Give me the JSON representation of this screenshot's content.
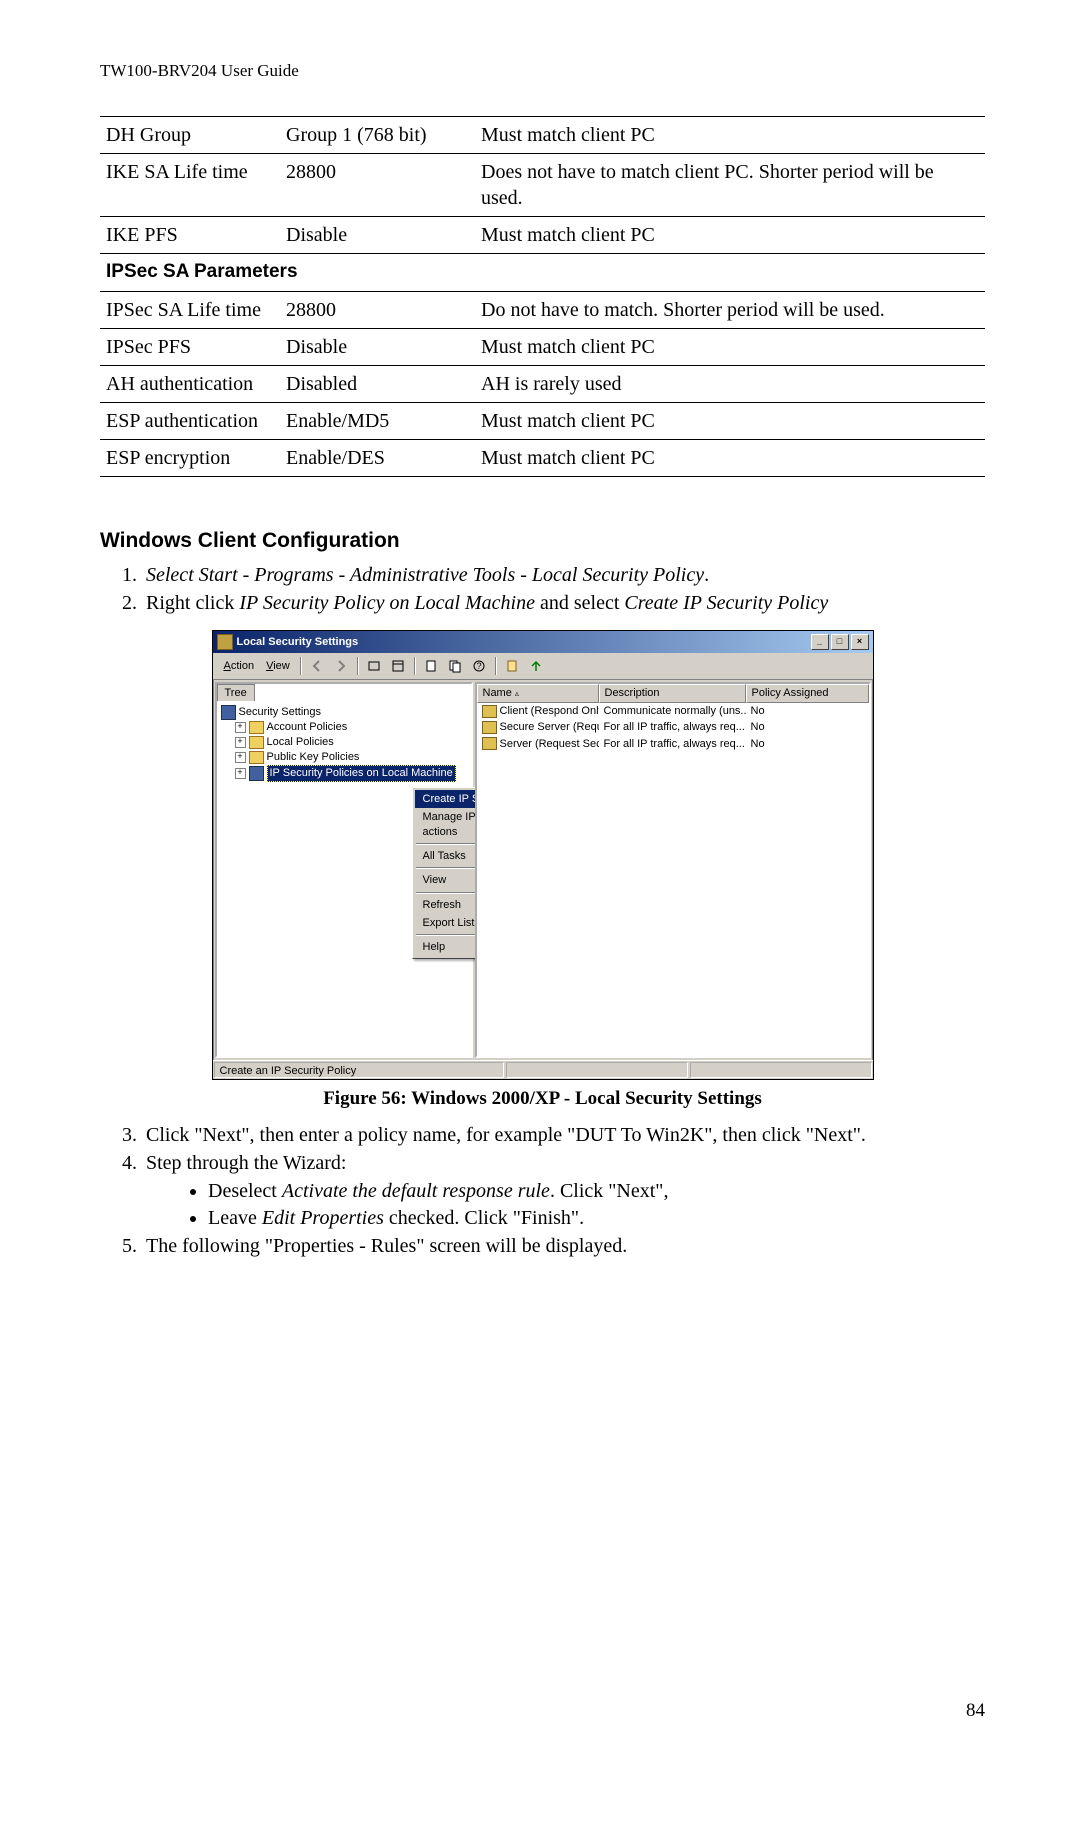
{
  "header": "TW100-BRV204 User Guide",
  "table": {
    "rows": [
      {
        "p": "DH Group",
        "v": "Group 1 (768 bit)",
        "n": "Must match client PC"
      },
      {
        "p": "IKE SA Life time",
        "v": "28800",
        "n": "Does not have to match client PC. Shorter period will be used."
      },
      {
        "p": "IKE PFS",
        "v": "Disable",
        "n": "Must match client PC"
      }
    ],
    "section2_title": "IPSec SA Parameters",
    "rows2": [
      {
        "p": "IPSec SA Life time",
        "v": "28800",
        "n": "Do not have to match. Shorter period will be used."
      },
      {
        "p": "IPSec PFS",
        "v": "Disable",
        "n": "Must match client PC"
      },
      {
        "p": "AH authentication",
        "v": "Disabled",
        "n": "AH is rarely used"
      },
      {
        "p": "ESP authentication",
        "v": "Enable/MD5",
        "n": "Must match client PC"
      },
      {
        "p": "ESP encryption",
        "v": "Enable/DES",
        "n": "Must match client PC"
      }
    ]
  },
  "heading": "Windows Client Configuration",
  "step1_italic": "Select Start - Programs - Administrative Tools - Local Security Policy",
  "step2_a": "Right click ",
  "step2_b": "IP Security Policy on Local Machine",
  "step2_c": " and select ",
  "step2_d": "Create IP Security Policy",
  "figure_caption": "Figure 56: Windows 2000/XP - Local Security Settings",
  "step3": "Click \"Next\", then enter a policy name, for example \"DUT To Win2K\", then click \"Next\".",
  "step4": "Step through the Wizard:",
  "step4_b1_a": "Deselect ",
  "step4_b1_b": "Activate the default response rule",
  "step4_b1_c": ".  Click \"Next\",",
  "step4_b2_a": "Leave ",
  "step4_b2_b": "Edit Properties",
  "step4_b2_c": " checked.  Click \"Finish\".",
  "step5": "The following \"Properties - Rules\" screen will be displayed.",
  "page_number": "84",
  "win2k": {
    "title": "Local Security Settings",
    "menu_action": "Action",
    "menu_view": "View",
    "tree_tab": "Tree",
    "tree_root": "Security Settings",
    "tree_n1": "Account Policies",
    "tree_n2": "Local Policies",
    "tree_n3": "Public Key Policies",
    "tree_n4": "IP Security Policies on Local Machine",
    "col_name": "Name",
    "col_desc": "Description",
    "col_assigned": "Policy Assigned",
    "r1_name": "Client (Respond Only)",
    "r1_desc": "Communicate normally (uns...",
    "r1_a": "No",
    "r2_name": "Secure Server (Requir...",
    "r2_desc": "For all IP traffic, always req...",
    "r2_a": "No",
    "r3_name": "Server (Request Secu...",
    "r3_desc": "For all IP traffic, always req...",
    "r3_a": "No",
    "ctx1": "Create IP Security Policy",
    "ctx2": "Manage IP filter lists and filter actions",
    "ctx3": "All Tasks",
    "ctx4": "View",
    "ctx5": "Refresh",
    "ctx6": "Export List...",
    "ctx7": "Help",
    "status": "Create an IP Security Policy"
  }
}
